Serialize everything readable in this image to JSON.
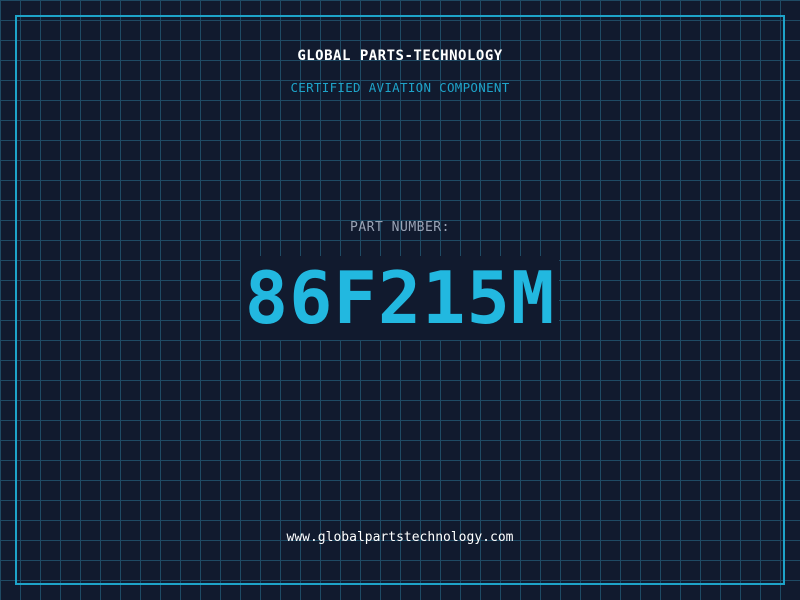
{
  "header": {
    "company": "GLOBAL PARTS-TECHNOLOGY",
    "subtitle": "CERTIFIED AVIATION COMPONENT"
  },
  "part": {
    "label": "PART NUMBER:",
    "number": "86F215M"
  },
  "footer": {
    "url": "www.globalpartstechnology.com"
  },
  "colors": {
    "background": "#111a2e",
    "grid": "#1f4a64",
    "accent": "#1ea3c8",
    "part_number": "#22b8e0",
    "label": "#9aa3b5",
    "text": "#ffffff"
  }
}
